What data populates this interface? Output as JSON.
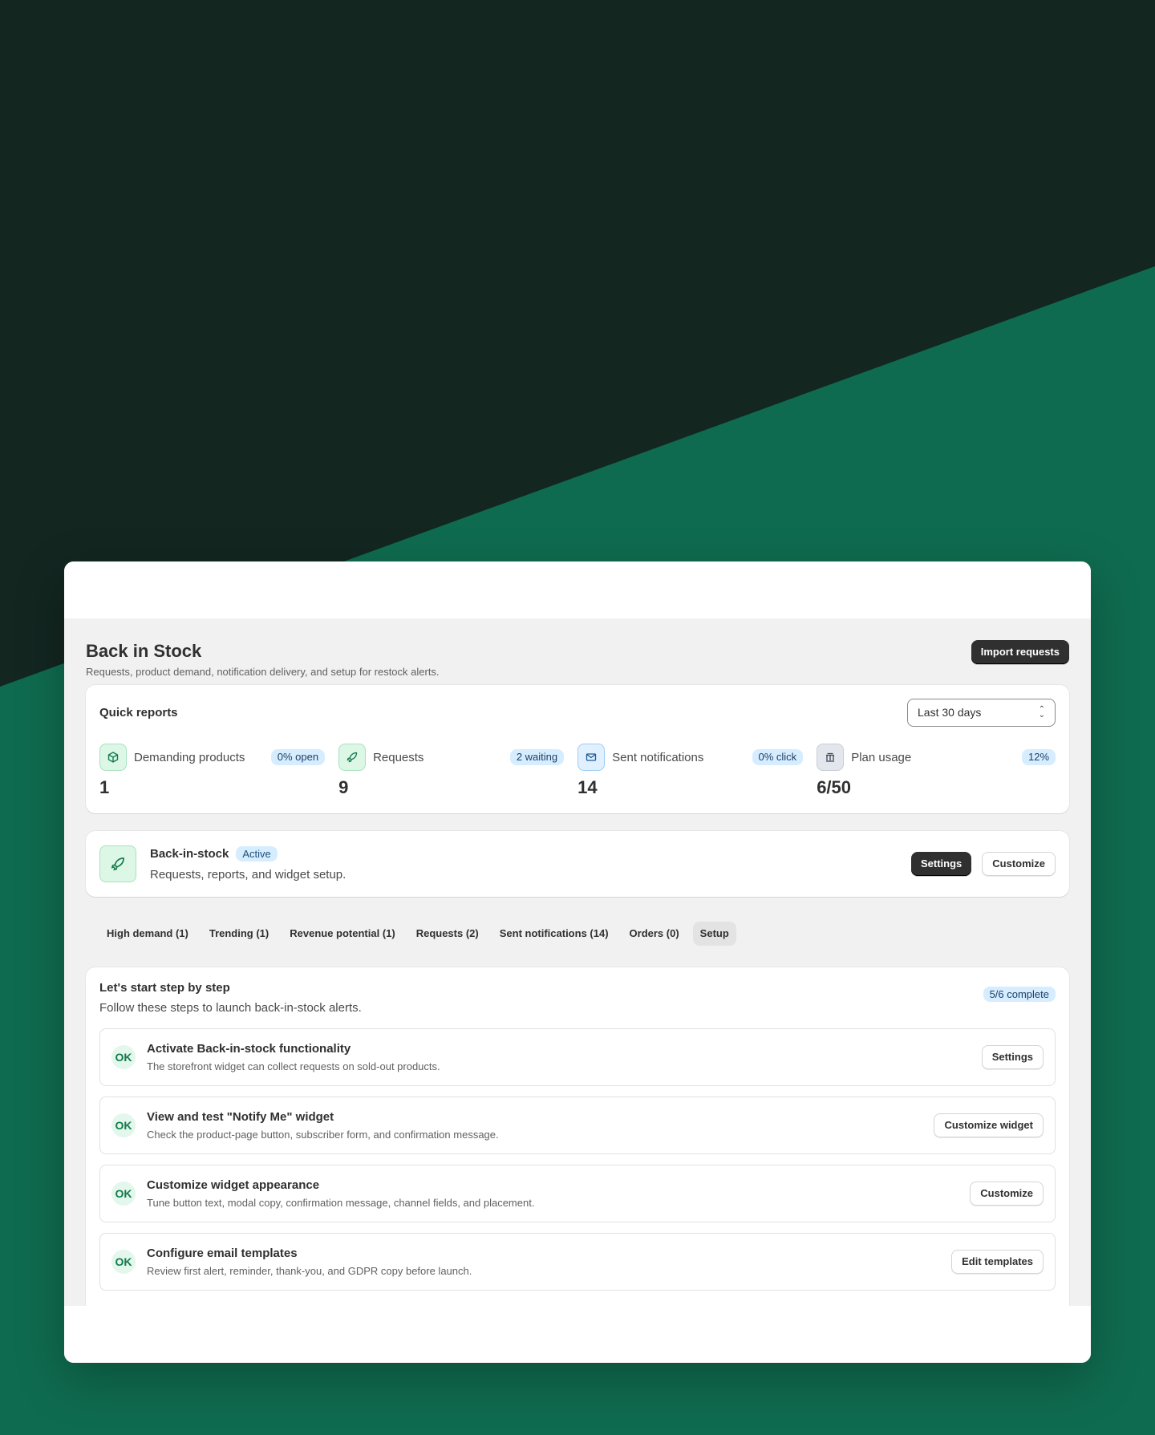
{
  "header": {
    "title": "Back in Stock",
    "subtitle": "Requests, product demand, notification delivery, and setup for restock alerts.",
    "import_label": "Import requests"
  },
  "reports": {
    "title": "Quick reports",
    "range": "Last 30 days",
    "stats": [
      {
        "label": "Demanding products",
        "badge": "0% open",
        "value": "1",
        "icon": "cube-icon"
      },
      {
        "label": "Requests",
        "badge": "2 waiting",
        "value": "9",
        "icon": "rocket-icon"
      },
      {
        "label": "Sent notifications",
        "badge": "0% click",
        "value": "14",
        "icon": "mail-icon"
      },
      {
        "label": "Plan usage",
        "badge": "12%",
        "value": "6/50",
        "icon": "bank-icon"
      }
    ]
  },
  "feature": {
    "title": "Back-in-stock",
    "status": "Active",
    "description": "Requests, reports, and widget setup.",
    "settings_label": "Settings",
    "customize_label": "Customize"
  },
  "tabs": [
    {
      "label": "High demand (1)"
    },
    {
      "label": "Trending (1)"
    },
    {
      "label": "Revenue potential (1)"
    },
    {
      "label": "Requests (2)"
    },
    {
      "label": "Sent notifications (14)"
    },
    {
      "label": "Orders (0)"
    },
    {
      "label": "Setup"
    }
  ],
  "steps": {
    "title": "Let's start step by step",
    "description": "Follow these steps to launch back-in-stock alerts.",
    "progress": "5/6 complete",
    "items": [
      {
        "badge": "OK",
        "title": "Activate Back-in-stock functionality",
        "description": "The storefront widget can collect requests on sold-out products.",
        "action": "Settings"
      },
      {
        "badge": "OK",
        "title": "View and test \"Notify Me\" widget",
        "description": "Check the product-page button, subscriber form, and confirmation message.",
        "action": "Customize widget"
      },
      {
        "badge": "OK",
        "title": "Customize widget appearance",
        "description": "Tune button text, modal copy, confirmation message, channel fields, and placement.",
        "action": "Customize"
      },
      {
        "badge": "OK",
        "title": "Configure email templates",
        "description": "Review first alert, reminder, thank-you, and GDPR copy before launch.",
        "action": "Edit templates"
      }
    ]
  }
}
